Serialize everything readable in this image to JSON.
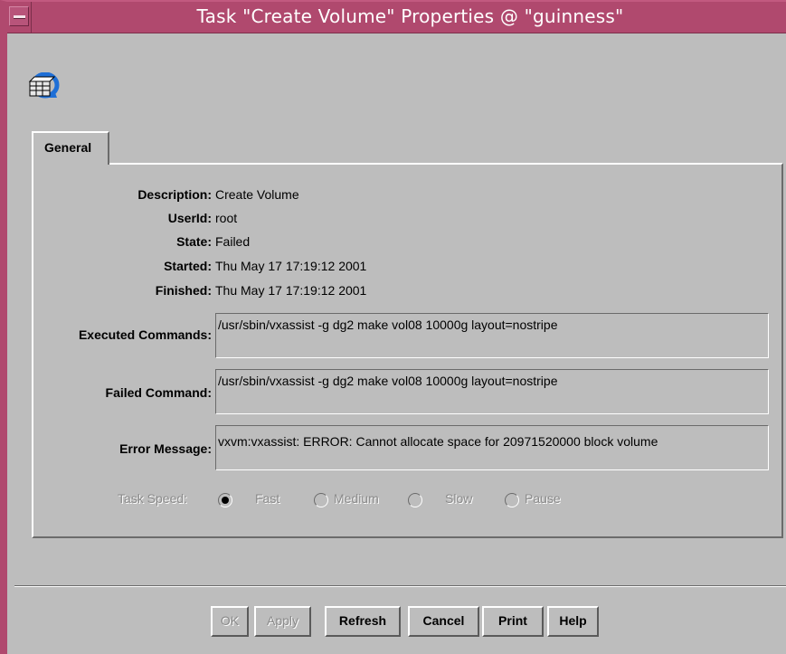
{
  "window": {
    "title": "Task \"Create Volume\" Properties @ \"guinness\""
  },
  "tabs": [
    {
      "label": "General",
      "selected": true
    }
  ],
  "details": {
    "description_label": "Description:",
    "description_value": "Create Volume",
    "userid_label": "UserId:",
    "userid_value": "root",
    "state_label": "State:",
    "state_value": "Failed",
    "started_label": "Started:",
    "started_value": "Thu May 17 17:19:12 2001",
    "finished_label": "Finished:",
    "finished_value": "Thu May 17 17:19:12 2001"
  },
  "commands": {
    "executed_label": "Executed Commands:",
    "executed_value": "/usr/sbin/vxassist  -g dg2   make vol08 10000g layout=nostripe",
    "failed_label": "Failed Command:",
    "failed_value": "/usr/sbin/vxassist  -g dg2   make vol08 10000g layout=nostripe",
    "error_label": "Error Message:",
    "error_value": "vxvm:vxassist: ERROR: Cannot allocate space for 20971520000 block volume"
  },
  "task_speed": {
    "label": "Task Speed:",
    "options": [
      "Fast",
      "Medium",
      "Slow",
      "Pause"
    ],
    "selected": "Fast",
    "enabled": false
  },
  "buttons": {
    "ok": "OK",
    "apply": "Apply",
    "refresh": "Refresh",
    "cancel": "Cancel",
    "print": "Print",
    "help": "Help"
  },
  "colors": {
    "titlebar": "#b0496e",
    "background": "#bdbdbd"
  },
  "icons": {
    "app_icon": "disk-array-icon",
    "window_menu": "window-menu-icon"
  }
}
